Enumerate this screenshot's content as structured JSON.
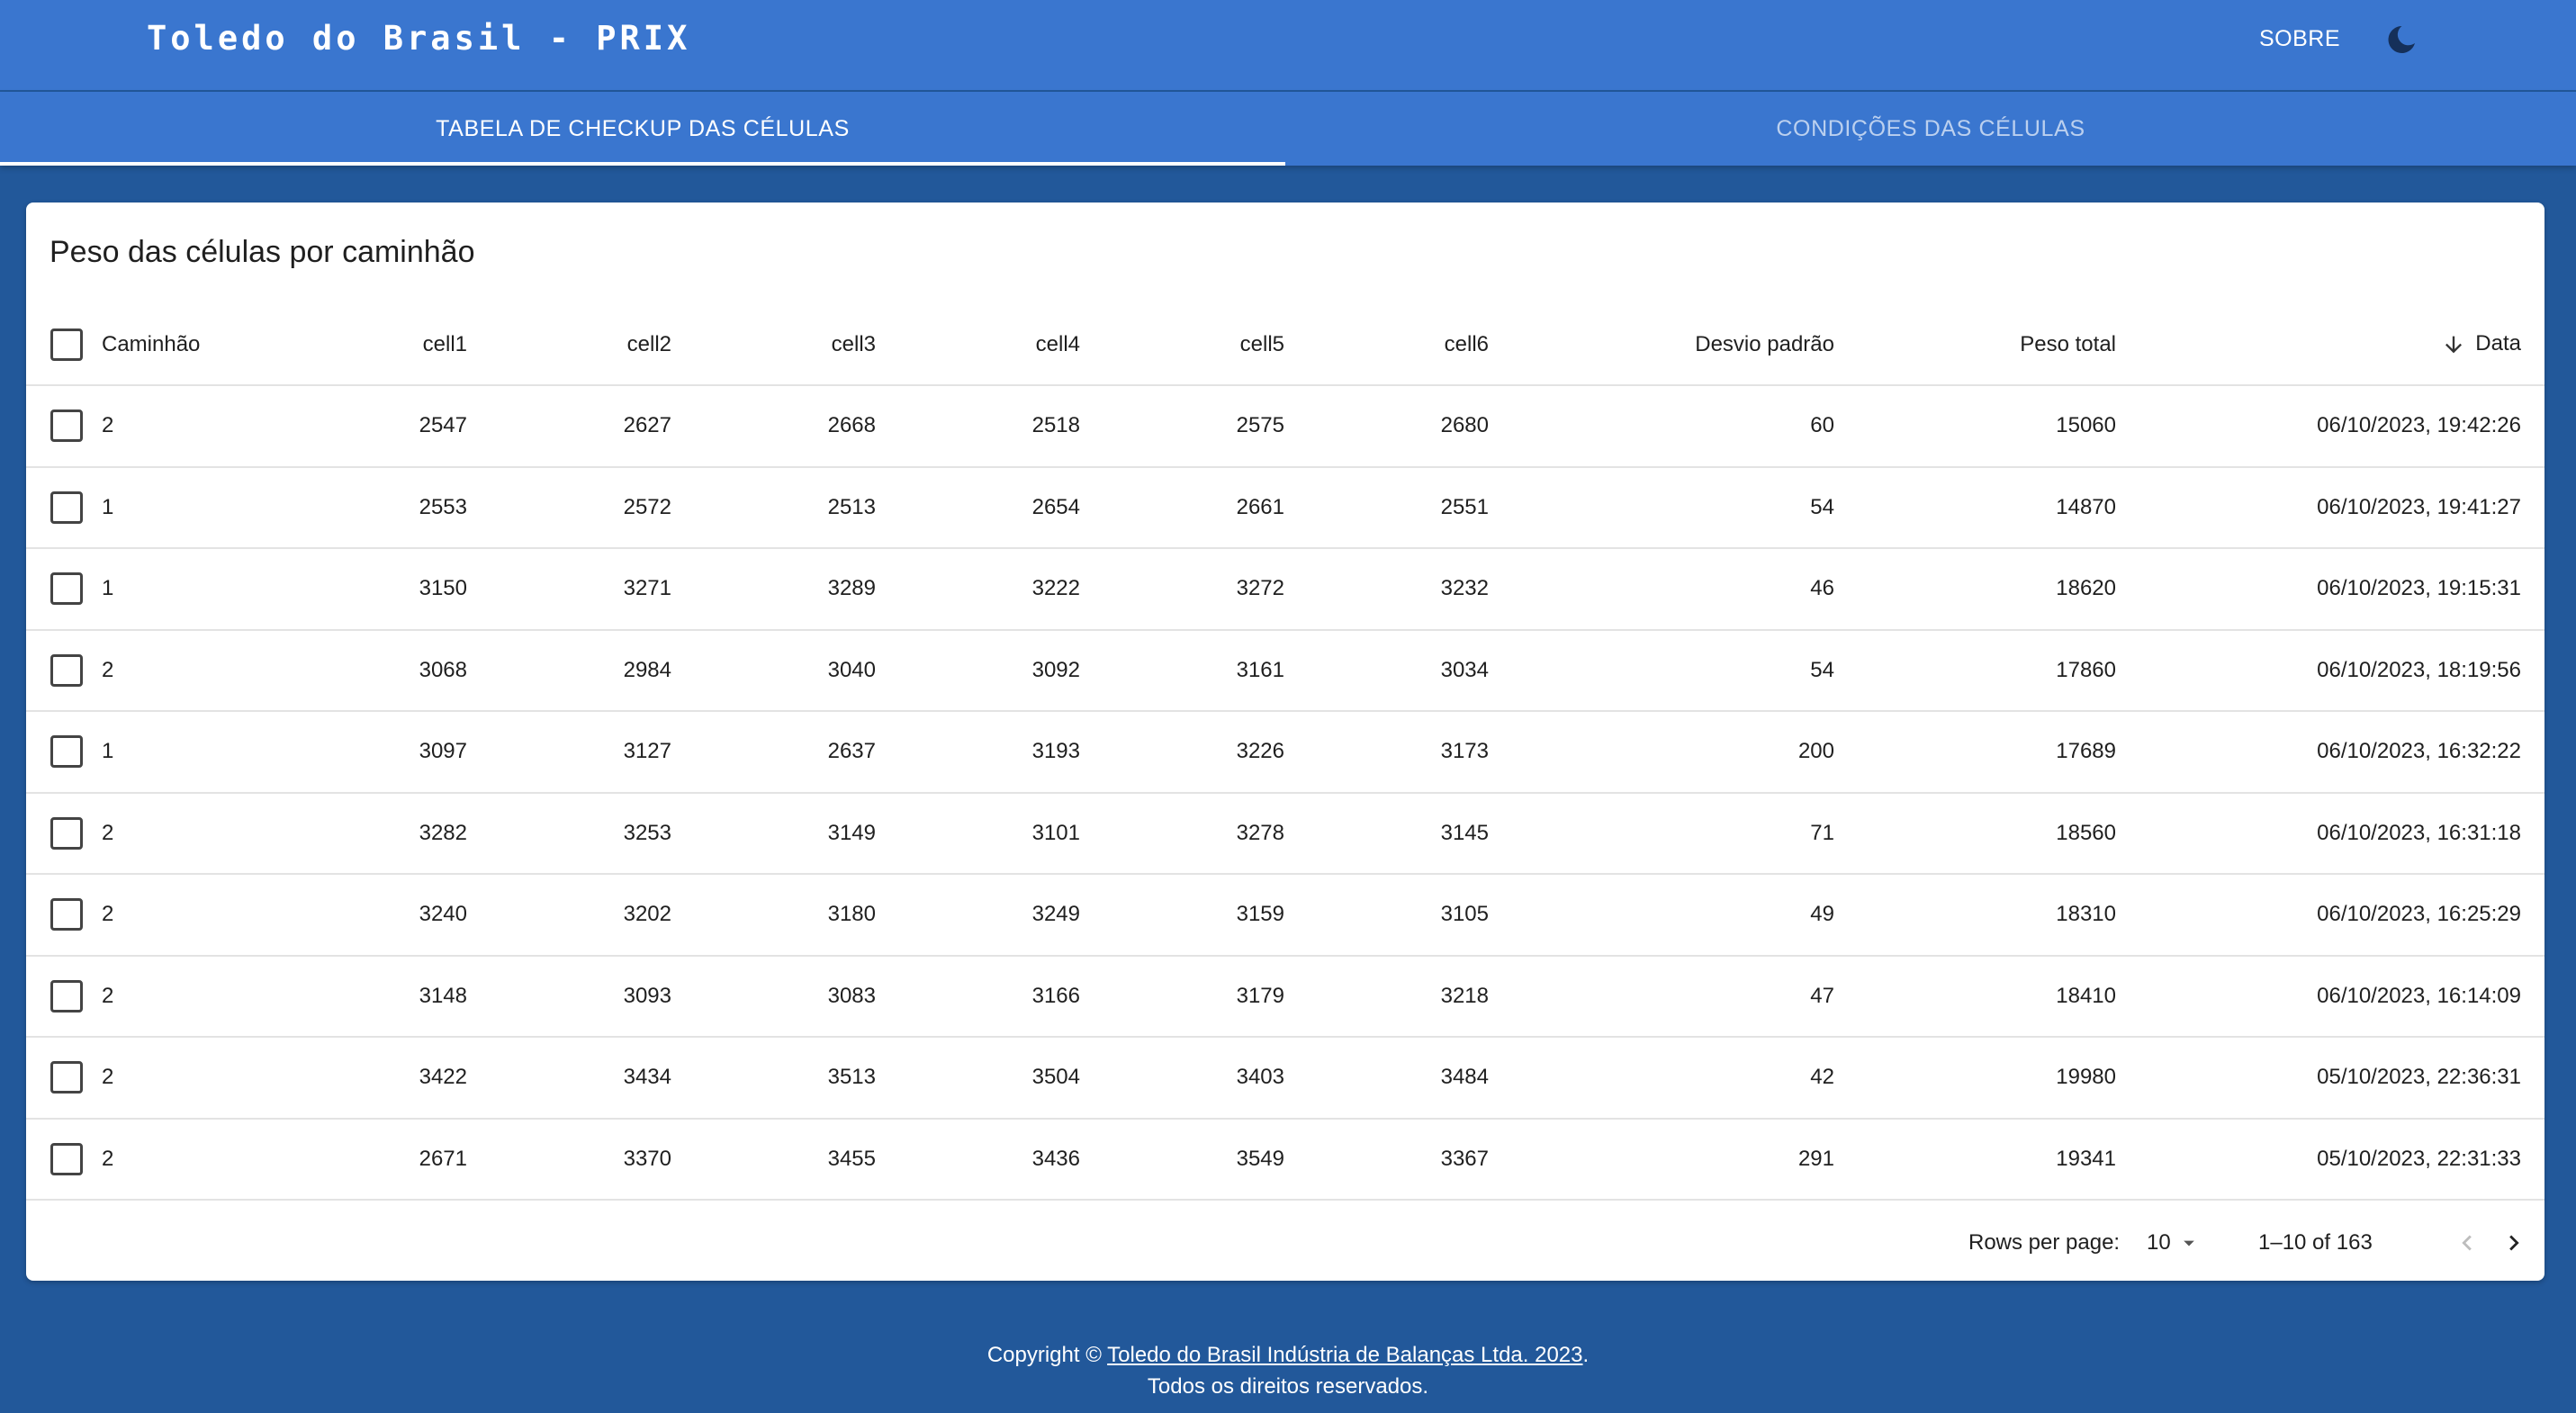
{
  "app": {
    "title": "Toledo do Brasil - PRIX",
    "about_label": "SOBRE",
    "theme_toggle_icon": "moon-icon"
  },
  "tabs": [
    {
      "label": "TABELA DE CHECKUP DAS CÉLULAS",
      "active": true
    },
    {
      "label": "CONDIÇÕES DAS CÉLULAS",
      "active": false
    }
  ],
  "table": {
    "title": "Peso das células por caminhão",
    "columns": [
      "Caminhão",
      "cell1",
      "cell2",
      "cell3",
      "cell4",
      "cell5",
      "cell6",
      "Desvio padrão",
      "Peso total",
      "Data"
    ],
    "sort": {
      "column": "Data",
      "direction": "desc",
      "icon": "arrow-down-icon"
    },
    "rows": [
      {
        "caminhao": "2",
        "cells": [
          "2547",
          "2627",
          "2668",
          "2518",
          "2575",
          "2680"
        ],
        "desvio": "60",
        "peso": "15060",
        "data": "06/10/2023, 19:42:26"
      },
      {
        "caminhao": "1",
        "cells": [
          "2553",
          "2572",
          "2513",
          "2654",
          "2661",
          "2551"
        ],
        "desvio": "54",
        "peso": "14870",
        "data": "06/10/2023, 19:41:27"
      },
      {
        "caminhao": "1",
        "cells": [
          "3150",
          "3271",
          "3289",
          "3222",
          "3272",
          "3232"
        ],
        "desvio": "46",
        "peso": "18620",
        "data": "06/10/2023, 19:15:31"
      },
      {
        "caminhao": "2",
        "cells": [
          "3068",
          "2984",
          "3040",
          "3092",
          "3161",
          "3034"
        ],
        "desvio": "54",
        "peso": "17860",
        "data": "06/10/2023, 18:19:56"
      },
      {
        "caminhao": "1",
        "cells": [
          "3097",
          "3127",
          "2637",
          "3193",
          "3226",
          "3173"
        ],
        "desvio": "200",
        "peso": "17689",
        "data": "06/10/2023, 16:32:22"
      },
      {
        "caminhao": "2",
        "cells": [
          "3282",
          "3253",
          "3149",
          "3101",
          "3278",
          "3145"
        ],
        "desvio": "71",
        "peso": "18560",
        "data": "06/10/2023, 16:31:18"
      },
      {
        "caminhao": "2",
        "cells": [
          "3240",
          "3202",
          "3180",
          "3249",
          "3159",
          "3105"
        ],
        "desvio": "49",
        "peso": "18310",
        "data": "06/10/2023, 16:25:29"
      },
      {
        "caminhao": "2",
        "cells": [
          "3148",
          "3093",
          "3083",
          "3166",
          "3179",
          "3218"
        ],
        "desvio": "47",
        "peso": "18410",
        "data": "06/10/2023, 16:14:09"
      },
      {
        "caminhao": "2",
        "cells": [
          "3422",
          "3434",
          "3513",
          "3504",
          "3403",
          "3484"
        ],
        "desvio": "42",
        "peso": "19980",
        "data": "05/10/2023, 22:36:31"
      },
      {
        "caminhao": "2",
        "cells": [
          "2671",
          "3370",
          "3455",
          "3436",
          "3549",
          "3367"
        ],
        "desvio": "291",
        "peso": "19341",
        "data": "05/10/2023, 22:31:33"
      }
    ]
  },
  "pagination": {
    "rows_per_page_label": "Rows per page:",
    "rows_per_page_value": "10",
    "range_label": "1–10 of 163"
  },
  "footer": {
    "prefix": "Copyright © ",
    "link_text": "Toledo do Brasil Indústria de Balanças Ltda. 2023",
    "suffix": ".",
    "line2": "Todos os direitos reservados."
  },
  "colors": {
    "appbar": "#3a76cf",
    "page_background": "#22589a",
    "card": "#ffffff",
    "text": "#1f1f1f"
  }
}
